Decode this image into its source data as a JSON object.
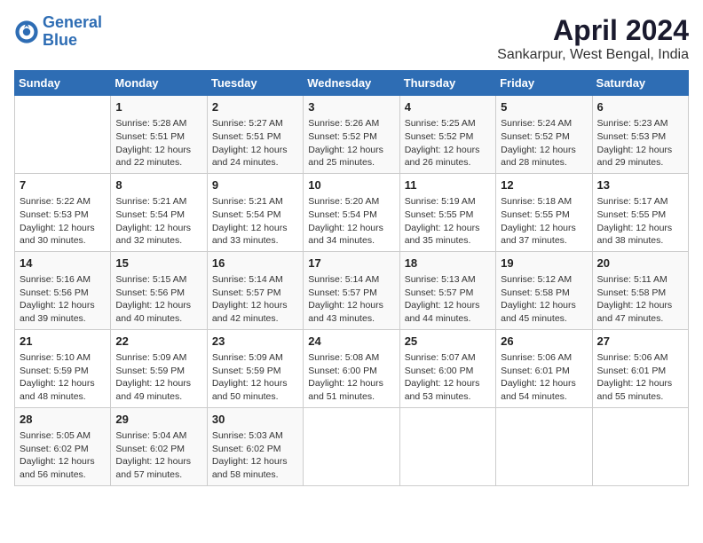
{
  "header": {
    "logo_line1": "General",
    "logo_line2": "Blue",
    "month_title": "April 2024",
    "location": "Sankarpur, West Bengal, India"
  },
  "weekdays": [
    "Sunday",
    "Monday",
    "Tuesday",
    "Wednesday",
    "Thursday",
    "Friday",
    "Saturday"
  ],
  "weeks": [
    [
      {
        "day": "",
        "info": ""
      },
      {
        "day": "1",
        "info": "Sunrise: 5:28 AM\nSunset: 5:51 PM\nDaylight: 12 hours\nand 22 minutes."
      },
      {
        "day": "2",
        "info": "Sunrise: 5:27 AM\nSunset: 5:51 PM\nDaylight: 12 hours\nand 24 minutes."
      },
      {
        "day": "3",
        "info": "Sunrise: 5:26 AM\nSunset: 5:52 PM\nDaylight: 12 hours\nand 25 minutes."
      },
      {
        "day": "4",
        "info": "Sunrise: 5:25 AM\nSunset: 5:52 PM\nDaylight: 12 hours\nand 26 minutes."
      },
      {
        "day": "5",
        "info": "Sunrise: 5:24 AM\nSunset: 5:52 PM\nDaylight: 12 hours\nand 28 minutes."
      },
      {
        "day": "6",
        "info": "Sunrise: 5:23 AM\nSunset: 5:53 PM\nDaylight: 12 hours\nand 29 minutes."
      }
    ],
    [
      {
        "day": "7",
        "info": "Sunrise: 5:22 AM\nSunset: 5:53 PM\nDaylight: 12 hours\nand 30 minutes."
      },
      {
        "day": "8",
        "info": "Sunrise: 5:21 AM\nSunset: 5:54 PM\nDaylight: 12 hours\nand 32 minutes."
      },
      {
        "day": "9",
        "info": "Sunrise: 5:21 AM\nSunset: 5:54 PM\nDaylight: 12 hours\nand 33 minutes."
      },
      {
        "day": "10",
        "info": "Sunrise: 5:20 AM\nSunset: 5:54 PM\nDaylight: 12 hours\nand 34 minutes."
      },
      {
        "day": "11",
        "info": "Sunrise: 5:19 AM\nSunset: 5:55 PM\nDaylight: 12 hours\nand 35 minutes."
      },
      {
        "day": "12",
        "info": "Sunrise: 5:18 AM\nSunset: 5:55 PM\nDaylight: 12 hours\nand 37 minutes."
      },
      {
        "day": "13",
        "info": "Sunrise: 5:17 AM\nSunset: 5:55 PM\nDaylight: 12 hours\nand 38 minutes."
      }
    ],
    [
      {
        "day": "14",
        "info": "Sunrise: 5:16 AM\nSunset: 5:56 PM\nDaylight: 12 hours\nand 39 minutes."
      },
      {
        "day": "15",
        "info": "Sunrise: 5:15 AM\nSunset: 5:56 PM\nDaylight: 12 hours\nand 40 minutes."
      },
      {
        "day": "16",
        "info": "Sunrise: 5:14 AM\nSunset: 5:57 PM\nDaylight: 12 hours\nand 42 minutes."
      },
      {
        "day": "17",
        "info": "Sunrise: 5:14 AM\nSunset: 5:57 PM\nDaylight: 12 hours\nand 43 minutes."
      },
      {
        "day": "18",
        "info": "Sunrise: 5:13 AM\nSunset: 5:57 PM\nDaylight: 12 hours\nand 44 minutes."
      },
      {
        "day": "19",
        "info": "Sunrise: 5:12 AM\nSunset: 5:58 PM\nDaylight: 12 hours\nand 45 minutes."
      },
      {
        "day": "20",
        "info": "Sunrise: 5:11 AM\nSunset: 5:58 PM\nDaylight: 12 hours\nand 47 minutes."
      }
    ],
    [
      {
        "day": "21",
        "info": "Sunrise: 5:10 AM\nSunset: 5:59 PM\nDaylight: 12 hours\nand 48 minutes."
      },
      {
        "day": "22",
        "info": "Sunrise: 5:09 AM\nSunset: 5:59 PM\nDaylight: 12 hours\nand 49 minutes."
      },
      {
        "day": "23",
        "info": "Sunrise: 5:09 AM\nSunset: 5:59 PM\nDaylight: 12 hours\nand 50 minutes."
      },
      {
        "day": "24",
        "info": "Sunrise: 5:08 AM\nSunset: 6:00 PM\nDaylight: 12 hours\nand 51 minutes."
      },
      {
        "day": "25",
        "info": "Sunrise: 5:07 AM\nSunset: 6:00 PM\nDaylight: 12 hours\nand 53 minutes."
      },
      {
        "day": "26",
        "info": "Sunrise: 5:06 AM\nSunset: 6:01 PM\nDaylight: 12 hours\nand 54 minutes."
      },
      {
        "day": "27",
        "info": "Sunrise: 5:06 AM\nSunset: 6:01 PM\nDaylight: 12 hours\nand 55 minutes."
      }
    ],
    [
      {
        "day": "28",
        "info": "Sunrise: 5:05 AM\nSunset: 6:02 PM\nDaylight: 12 hours\nand 56 minutes."
      },
      {
        "day": "29",
        "info": "Sunrise: 5:04 AM\nSunset: 6:02 PM\nDaylight: 12 hours\nand 57 minutes."
      },
      {
        "day": "30",
        "info": "Sunrise: 5:03 AM\nSunset: 6:02 PM\nDaylight: 12 hours\nand 58 minutes."
      },
      {
        "day": "",
        "info": ""
      },
      {
        "day": "",
        "info": ""
      },
      {
        "day": "",
        "info": ""
      },
      {
        "day": "",
        "info": ""
      }
    ]
  ]
}
